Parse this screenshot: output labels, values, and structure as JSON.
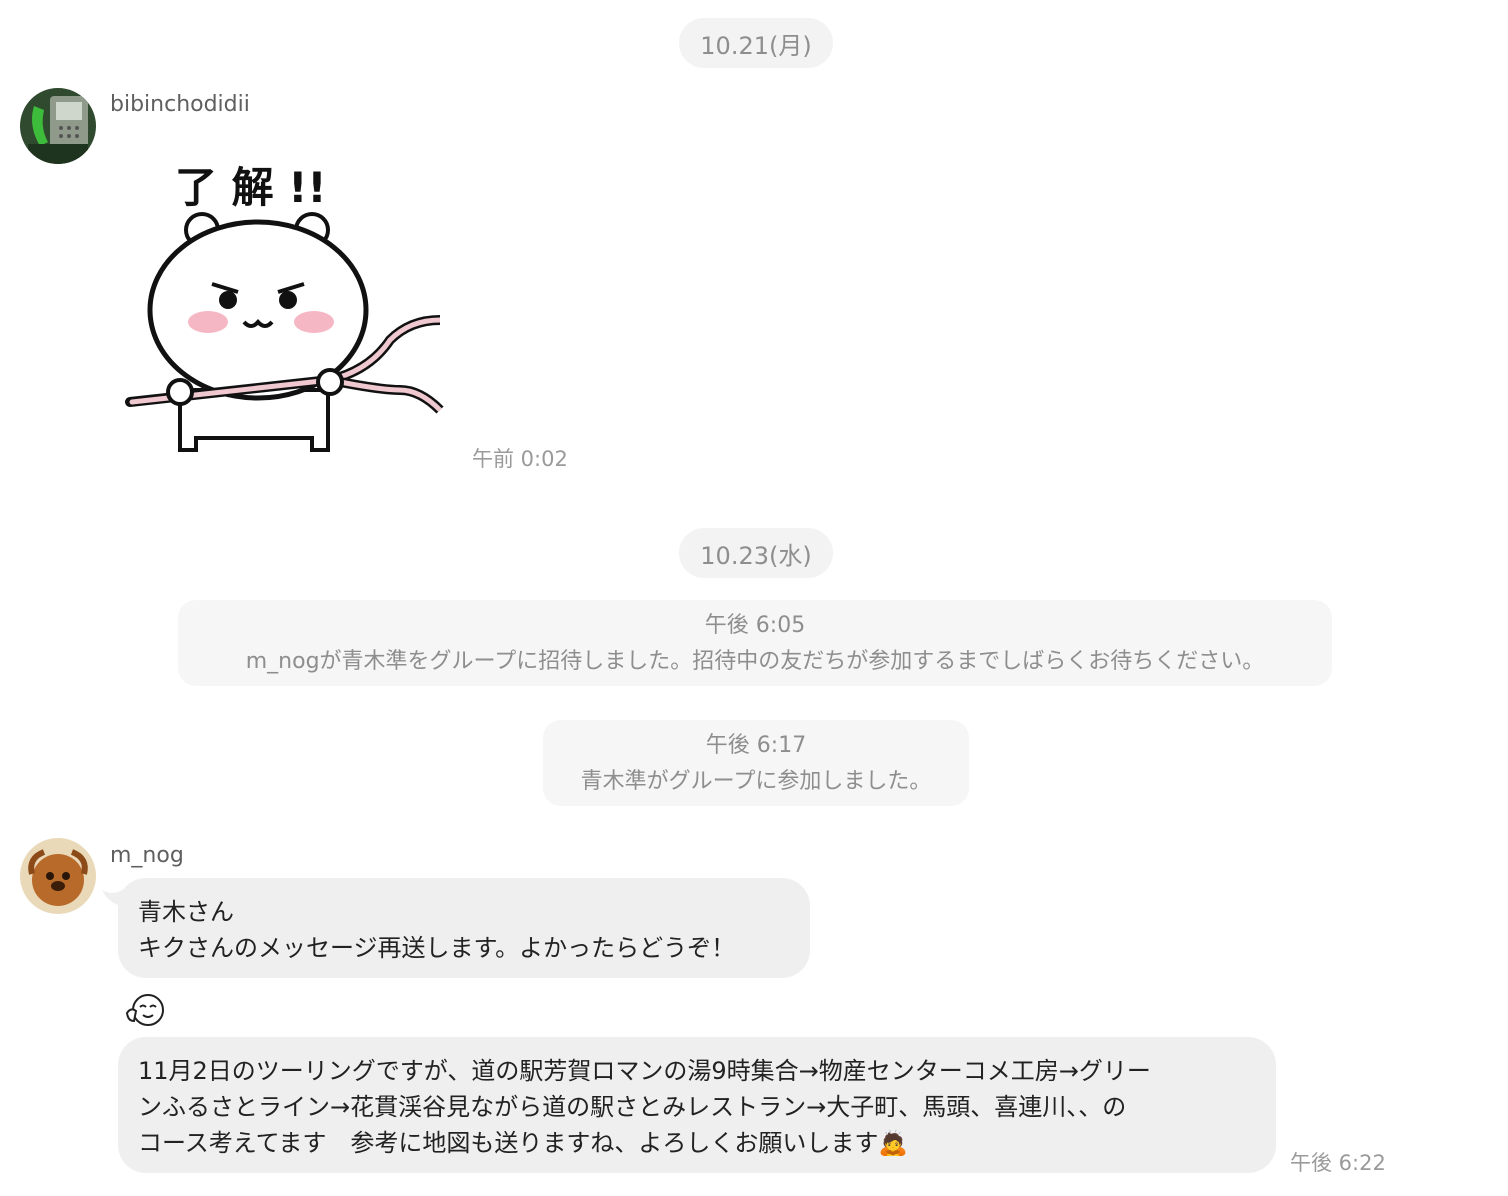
{
  "dates": [
    "10.21(月)",
    "10.23(水)"
  ],
  "msg1": {
    "sender": "bibinchodidii",
    "sticker_text": "了 解 !!",
    "time": "午前 0:02",
    "avatar": "phone-booth-photo-avatar"
  },
  "system": [
    {
      "time": "午後 6:05",
      "text": "m_nogが青木準をグループに招待しました。招待中の友だちが参加するまでしばらくお待ちください。"
    },
    {
      "time": "午後 6:17",
      "text": "青木準がグループに参加しました。"
    }
  ],
  "msg2": {
    "sender": "m_nog",
    "avatar": "dog-photo-avatar",
    "bubble1": [
      "青木さん",
      "キクさんのメッセージ再送します。よかったらどうぞ！"
    ],
    "emoji": "relieved-face-icon",
    "bubble2": [
      "11月2日のツーリングですが、道の駅芳賀ロマンの湯9時集合→物産センターコメ工房→グリー",
      "ンふるさとライン→花貫渓谷見ながら道の駅さとみレストラン→大子町、馬頭、喜連川、、の",
      "コース考えてます　参考に地図も送りますね、よろしくお願いします"
    ],
    "bubble2_end_emoji": "🙇",
    "time": "午後 6:22"
  }
}
